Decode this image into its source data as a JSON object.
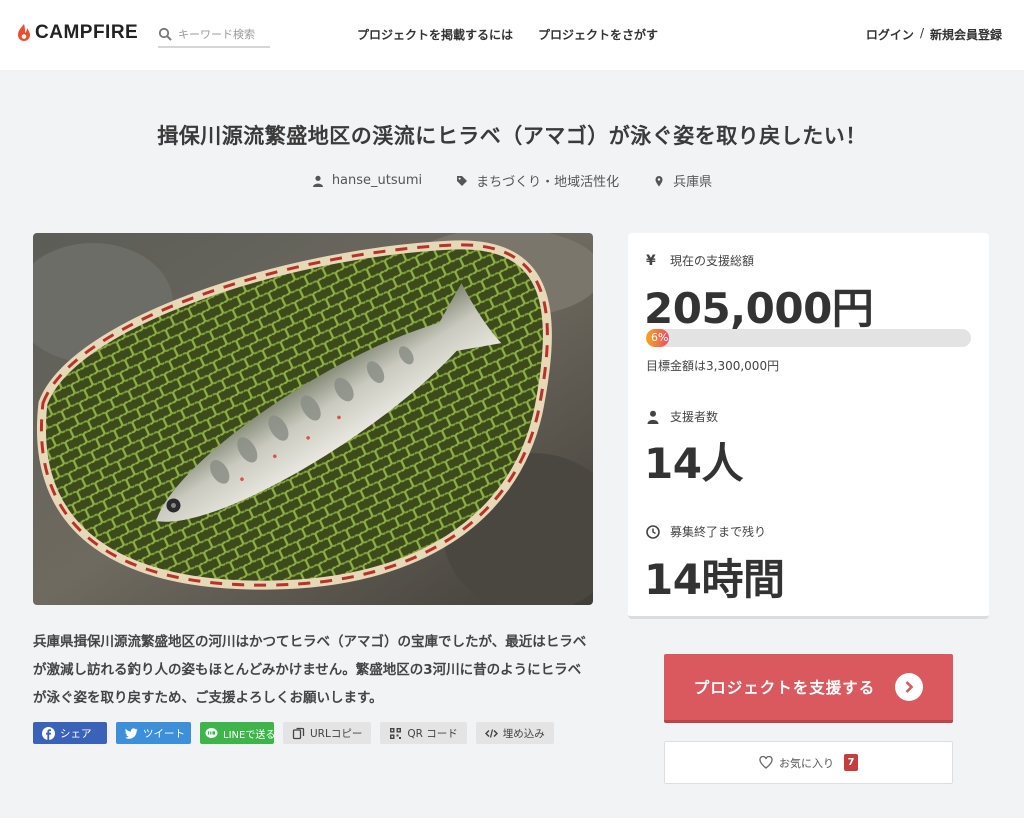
{
  "header": {
    "logo_text": "CAMPFIRE",
    "search_placeholder": "キーワード検索",
    "nav": [
      "プロジェクトを掲載するには",
      "プロジェクトをさがす"
    ],
    "login": "ログイン",
    "separator": "/",
    "signup": "新規会員登録"
  },
  "project": {
    "title": "揖保川源流繁盛地区の渓流にヒラベ（アマゴ）が泳ぐ姿を取り戻したい！",
    "owner": "hanse_utsumi",
    "category": "まちづくり・地域活性化",
    "location": "兵庫県",
    "description": "兵庫県揖保川源流繁盛地区の河川はかつてヒラベ（アマゴ）の宝庫でしたが、最近はヒラベが激減し訪れる釣り人の姿もほとんどみかけません。繁盛地区の3河川に昔のようにヒラベが泳ぐ姿を取り戻すため、ご支援よろしくお願いします。"
  },
  "share": {
    "facebook": "シェア",
    "twitter": "ツイート",
    "line": "LINEで送る",
    "url_copy": "URLコピー",
    "qr": "QR コード",
    "embed": "埋め込み"
  },
  "stats": {
    "amount_label": "現在の支援総額",
    "amount_icon": "yen-icon",
    "yen_symbol": "¥",
    "amount": "205,000円",
    "progress_percent": 6,
    "progress_text": "6%",
    "goal": "目標金額は3,300,000円",
    "backers_label": "支援者数",
    "backers": "14人",
    "remaining_label": "募集終了まで残り",
    "remaining": "14時間"
  },
  "actions": {
    "support_label": "プロジェクトを支援する",
    "favorite_label": "お気に入り",
    "favorite_count": "7"
  },
  "colors": {
    "accent": "#d9595f",
    "facebook": "#3b62b9",
    "twitter": "#3d8fd9",
    "line": "#3eb54a"
  }
}
